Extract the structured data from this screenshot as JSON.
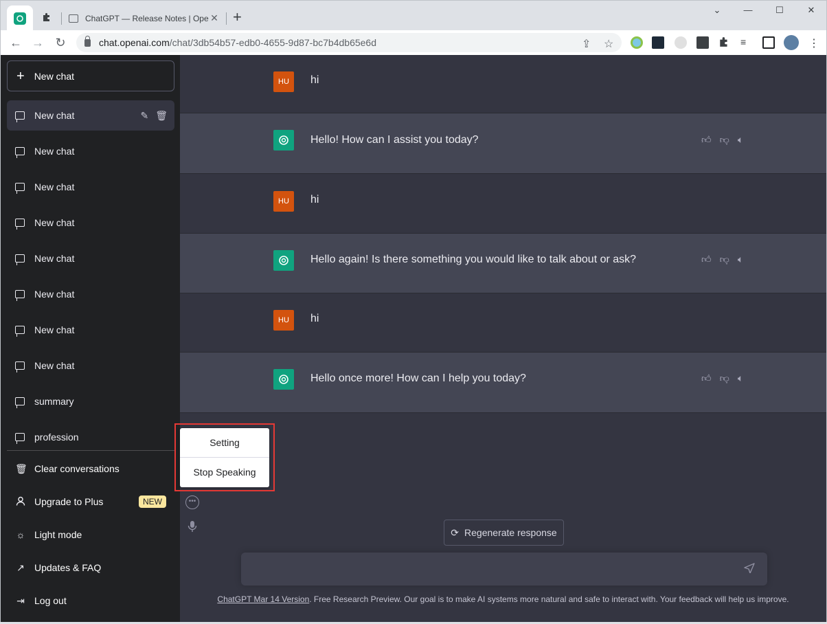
{
  "browser": {
    "tab_title": "ChatGPT — Release Notes | Oper",
    "url_host": "chat.openai.com",
    "url_path": "/chat/3db54b57-edb0-4655-9d87-bc7b4db65e6d"
  },
  "sidebar": {
    "new_chat_label": "New chat",
    "chats": [
      {
        "label": "New chat"
      },
      {
        "label": "New chat"
      },
      {
        "label": "New chat"
      },
      {
        "label": "New chat"
      },
      {
        "label": "New chat"
      },
      {
        "label": "New chat"
      },
      {
        "label": "New chat"
      },
      {
        "label": "New chat"
      },
      {
        "label": "summary"
      },
      {
        "label": "profession"
      }
    ],
    "menu": {
      "clear": "Clear conversations",
      "upgrade": "Upgrade to Plus",
      "upgrade_badge": "NEW",
      "light_mode": "Light mode",
      "updates": "Updates & FAQ",
      "logout": "Log out"
    }
  },
  "conversation": [
    {
      "role": "user",
      "avatar": "HU",
      "text": "hi"
    },
    {
      "role": "assistant",
      "text": "Hello! How can I assist you today?"
    },
    {
      "role": "user",
      "avatar": "HU",
      "text": "hi"
    },
    {
      "role": "assistant",
      "text": "Hello again! Is there something you would like to talk about or ask?"
    },
    {
      "role": "user",
      "avatar": "HU",
      "text": "hi"
    },
    {
      "role": "assistant",
      "text": "Hello once more! How can I help you today?"
    }
  ],
  "popup": {
    "setting": "Setting",
    "stop_speaking": "Stop Speaking"
  },
  "regenerate_label": "Regenerate response",
  "footer": {
    "version_link": "ChatGPT Mar 14 Version",
    "text": ". Free Research Preview. Our goal is to make AI systems more natural and safe to interact with. Your feedback will help us improve."
  },
  "colors": {
    "sidebar_bg": "#202123",
    "main_bg": "#343541",
    "bot_row_bg": "#444654",
    "user_avatar": "#d3530e",
    "gpt_avatar": "#10a37f",
    "highlight_border": "#e53935"
  }
}
